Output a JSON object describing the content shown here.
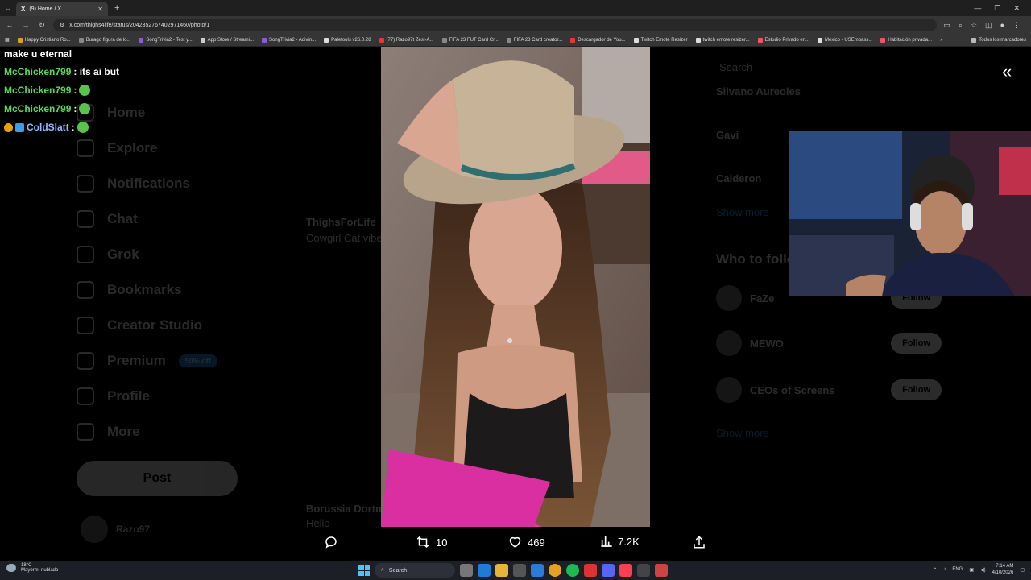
{
  "browser": {
    "tab_title": "(9) Home / X",
    "tab_logo": "X",
    "new_tab": "+",
    "url": "x.com/thighs4life/status/2042352767402971460/photo/1",
    "bookmarks": [
      "Happy Cristiano Ro...",
      "Burago figura de lo...",
      "SongTrivia2 - Test y...",
      "App Store / Streami...",
      "SongTrivia2 - Adivin...",
      "Paletools v26.0.28",
      "(77) Razo97t Zest-A...",
      "FIFA 23 FUT Card Cr...",
      "FIFA 23 Card creator...",
      "Descargador de You...",
      "Twitch Emote Resizer",
      "twitch emote resizer...",
      "Estudio Privado en...",
      "Mexico - USEmbass...",
      "Habitación privada..."
    ],
    "bookmarks_more": "»",
    "all_bookmarks": "Todos los marcadores"
  },
  "x_sidebar": {
    "items": [
      "Home",
      "Explore",
      "Notifications",
      "Chat",
      "Grok",
      "Bookmarks",
      "Creator Studio",
      "Premium",
      "Profile",
      "More"
    ],
    "premium_badge": "50% off",
    "post_button": "Post",
    "account_name": "Razo97"
  },
  "background_feed": {
    "post_author_1": "ThighsForLife",
    "post_text_1": "Cowgirl Cat vibe",
    "post_author_2": "Borussia Dortm...",
    "post_text_2": "Hello"
  },
  "right_panel": {
    "search_placeholder": "Search",
    "trend_1": "Silvano Aureoles",
    "trend_2": "Gavi",
    "trend_3": "Calderon",
    "trend_4": "Show more",
    "who_to_follow": "Who to follow",
    "suggestions": [
      {
        "name": "FaZe",
        "button": "Follow"
      },
      {
        "name": "MEWO",
        "button": "Follow"
      },
      {
        "name": "CEOs of Screens",
        "button": "Follow"
      }
    ],
    "show_more": "Show more"
  },
  "post_actions": {
    "reply_count": "",
    "repost_count": "10",
    "like_count": "469",
    "view_count": "7.2K"
  },
  "stream_chat": [
    {
      "user": "",
      "text": "make u eternal"
    },
    {
      "user": "McChicken799",
      "text": " : its ai but"
    },
    {
      "user": "McChicken799",
      "text": " :"
    },
    {
      "user": "McChicken799",
      "text": " :"
    },
    {
      "user": "ColdSlatt",
      "text": " :"
    }
  ],
  "taskbar": {
    "temp": "18°C",
    "weather_desc": "Mayorm. nublado",
    "search_label": "Search",
    "lang": "ENG",
    "time": "7:14 AM",
    "date": "4/10/2026"
  },
  "icons": {
    "collapse": "double-chevron-left-icon",
    "reply": "reply-icon",
    "repost": "repost-icon",
    "like": "heart-icon",
    "views": "views-icon",
    "share": "share-icon"
  },
  "colors": {
    "x_blue": "#1d9bf0",
    "chat_green": "#56d956",
    "background": "#000000"
  }
}
